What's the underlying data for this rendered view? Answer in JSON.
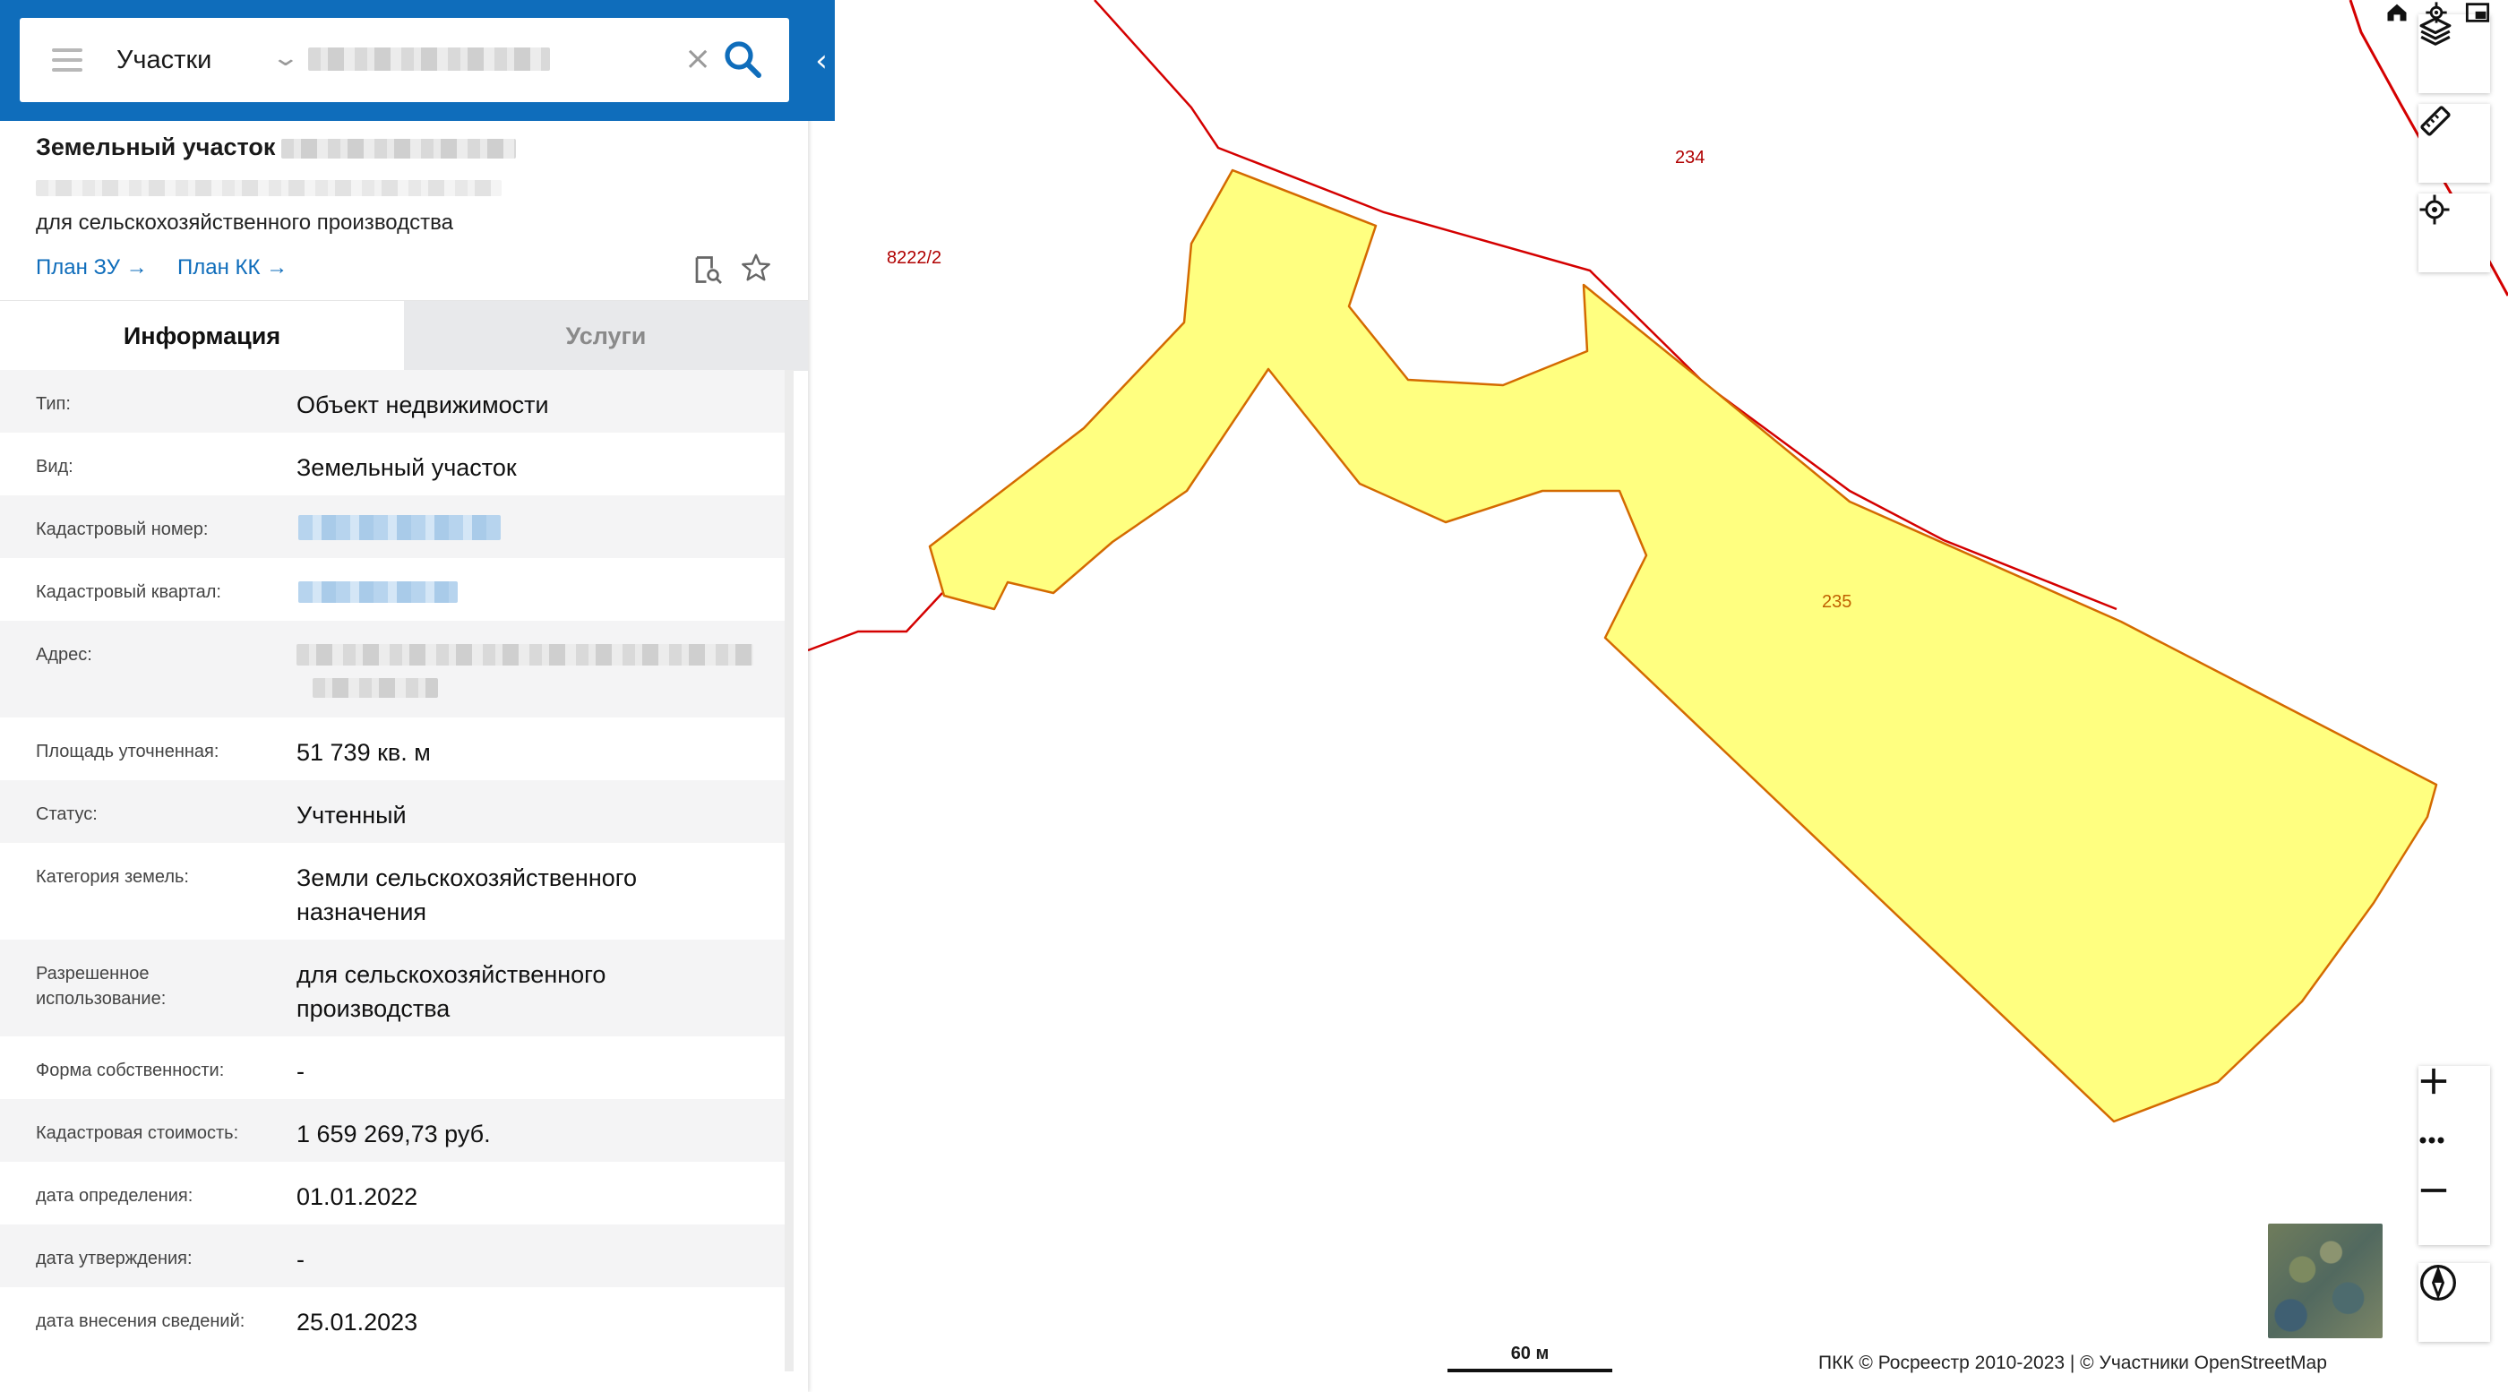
{
  "search": {
    "layer_label": "Участки",
    "input_value": "",
    "clear_icon": "close-icon",
    "search_icon": "search-icon",
    "menu_icon": "hamburger-icon",
    "collapse_icon": "chevron-left-icon"
  },
  "object": {
    "title": "Земельный участок",
    "purpose": "для сельскохозяйственного производства",
    "links": [
      "План ЗУ →",
      "План КК →"
    ]
  },
  "tabs": [
    {
      "label": "Информация",
      "active": true
    },
    {
      "label": "Услуги",
      "active": false
    }
  ],
  "info_rows": [
    {
      "label": "Тип:",
      "value": "Объект недвижимости"
    },
    {
      "label": "Вид:",
      "value": "Земельный участок"
    },
    {
      "label": "Кадастровый номер:",
      "value": ""
    },
    {
      "label": "Кадастровый квартал:",
      "value": ""
    },
    {
      "label": "Адрес:",
      "value": ""
    },
    {
      "label": "Площадь уточненная:",
      "value": "51 739 кв. м"
    },
    {
      "label": "Статус:",
      "value": "Учтенный"
    },
    {
      "label": "Категория земель:",
      "value": "Земли сельскохозяйственного назначения"
    },
    {
      "label": "Разрешенное использование:",
      "value": "для сельскохозяйственного производства"
    },
    {
      "label": "Форма собственности:",
      "value": "-"
    },
    {
      "label": "Кадастровая стоимость:",
      "value": "1 659 269,73 руб."
    },
    {
      "label": "дата определения:",
      "value": "01.01.2022"
    },
    {
      "label": "дата утверждения:",
      "value": "-"
    },
    {
      "label": "дата внесения сведений:",
      "value": "25.01.2023"
    }
  ],
  "map": {
    "parcel_labels": [
      "234",
      "8222/2",
      "235"
    ],
    "selected_fill": "#ffff80",
    "boundary_color": "#d40000",
    "scale_label": "60 м",
    "attribution": "ПКК © Росреестр 2010-2023 | © Участники OpenStreetMap",
    "controls": [
      "layers-icon",
      "ruler-icon",
      "locate-icon",
      "zoom-in-icon",
      "more-icon",
      "zoom-out-icon",
      "compass-icon"
    ]
  }
}
